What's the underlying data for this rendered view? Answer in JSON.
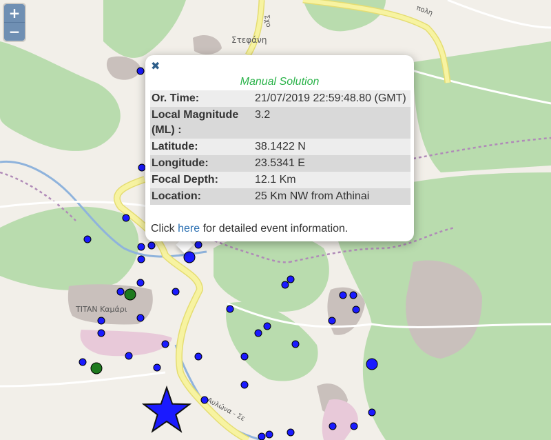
{
  "map": {
    "places": [
      {
        "name": "Στεφάνη"
      },
      {
        "name": "TITAN Καμάρι"
      }
    ],
    "road_labels": [
      "Σχο",
      "πολη",
      "Αυλώνα",
      "Αυλώνα - Σε"
    ]
  },
  "zoom": {
    "in_label": "+",
    "out_label": "−"
  },
  "popup": {
    "close_symbol": "✖",
    "title": "Manual Solution",
    "rows": [
      {
        "key": "Or. Time:",
        "value": "21/07/2019 22:59:48.80 (GMT)"
      },
      {
        "key": "Local Magnitude (ML) :",
        "value": "3.2"
      },
      {
        "key": "Latitude:",
        "value": "38.1422 N"
      },
      {
        "key": "Longitude:",
        "value": "23.5341 E"
      },
      {
        "key": "Focal Depth:",
        "value": "12.1 Km"
      },
      {
        "key": "Location:",
        "value": "25 Km NW from Athinai"
      }
    ],
    "click_prefix": "Click ",
    "click_link": "here",
    "click_suffix": " for detailed event information."
  },
  "colors": {
    "event_blue": "#1a1aff",
    "event_green": "#1e7a1e",
    "star": "#1a1aff",
    "forest": "#a6d3a0",
    "road_yellow": "#f7f3a1",
    "water": "#8fb3dc"
  }
}
